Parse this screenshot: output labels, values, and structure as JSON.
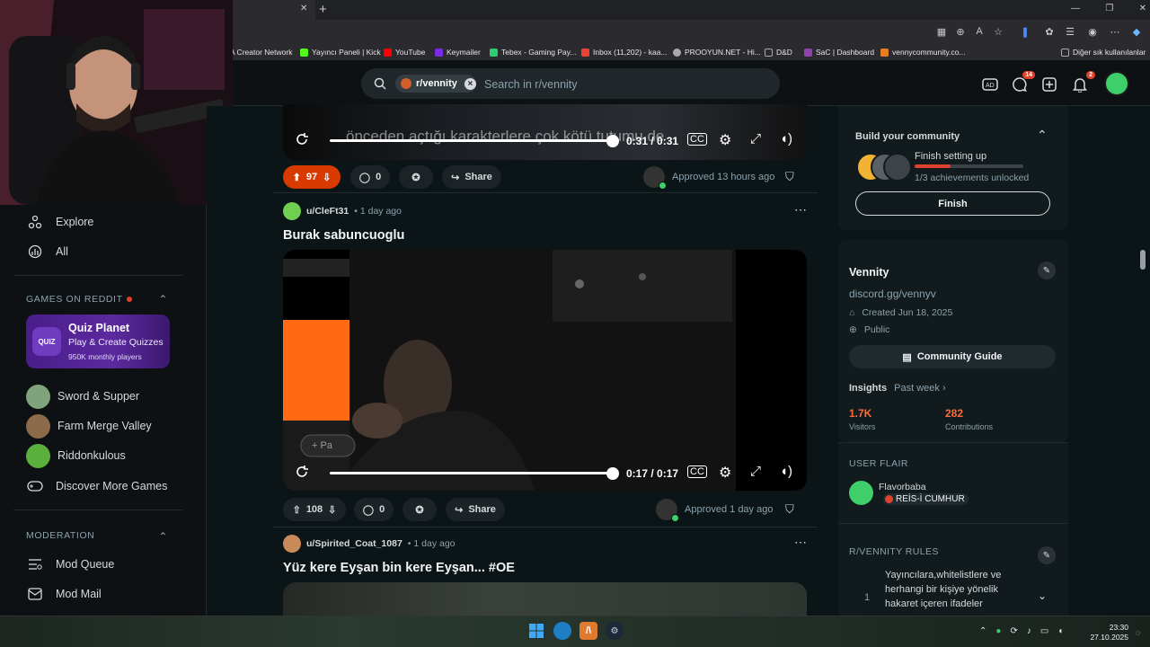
{
  "browser": {
    "tab_close": "✕",
    "new_tab": "+",
    "bookmarks": [
      {
        "label": "A Creator Network",
        "color": "#3b6fe0"
      },
      {
        "label": "Yayıncı Paneli | Kick",
        "color": "#53fc18"
      },
      {
        "label": "YouTube",
        "color": "#ff0000"
      },
      {
        "label": "Keymailer",
        "color": "#7d2ae8"
      },
      {
        "label": "Tebex - Gaming Pay...",
        "color": "#2ecc71"
      },
      {
        "label": "Inbox (11,202) - kaa...",
        "color": "#ea4335"
      },
      {
        "label": "PROOYUN.NET - Hi...",
        "color": "#aaaaaa"
      },
      {
        "label": "D&D",
        "color": "#aaaaaa"
      },
      {
        "label": "SaC | Dashboard",
        "color": "#8e44ad"
      },
      {
        "label": "vennycommunity.co...",
        "color": "#e67e22"
      }
    ],
    "other_bookmarks": "Diğer sık kullanılanlar",
    "window_controls": [
      "—",
      "❐",
      "✕"
    ]
  },
  "header": {
    "search_chip": "r/vennity",
    "search_placeholder": "Search in r/vennity",
    "chat_badge": "14",
    "notif_badge": "2"
  },
  "sidebar": {
    "nav": [
      {
        "label": "Explore",
        "icon": "explore-icon"
      },
      {
        "label": "All",
        "icon": "all-icon"
      }
    ],
    "games_header": "GAMES ON REDDIT",
    "quiz": {
      "title": "Quiz Planet",
      "subtitle": "Play & Create Quizzes",
      "players": "950K monthly players",
      "logo": "QUIZ"
    },
    "games": [
      {
        "label": "Sword & Supper",
        "color": "#7fa37a"
      },
      {
        "label": "Farm Merge Valley",
        "color": "#8c6b4a"
      },
      {
        "label": "Riddonkulous",
        "color": "#5ab03a"
      }
    ],
    "discover": "Discover More Games",
    "moderation_header": "MODERATION",
    "mod_items": [
      {
        "label": "Mod Queue",
        "icon": "mod-queue-icon"
      },
      {
        "label": "Mod Mail",
        "icon": "mod-mail-icon"
      }
    ]
  },
  "posts": [
    {
      "subtitle_overlay": "önceden açtığı karakterlere çok kötü tutumu de",
      "time": "0:31 / 0:31",
      "votes": "97",
      "comments": "0",
      "share": "Share",
      "approved": "Approved 13 hours ago",
      "upvote_color": "#d93a00"
    },
    {
      "author": "u/CleFt31",
      "age": "• 1 day ago",
      "title": "Burak sabuncuoglu",
      "time": "0:17 / 0:17",
      "votes": "108",
      "comments": "0",
      "share": "Share",
      "approved": "Approved 1 day ago",
      "video_button": "+ Pa"
    },
    {
      "author": "u/Spirited_Coat_1087",
      "age": "• 1 day ago",
      "title": "Yüz kere Eyşan bin kere Eyşan... #OE"
    }
  ],
  "right": {
    "build": {
      "title": "Build your community",
      "setup": "Finish setting up",
      "achievements": "1/3 achievements unlocked",
      "progress": 0.33,
      "finish": "Finish"
    },
    "community": {
      "name": "Vennity",
      "desc": "discord.gg/vennyv",
      "created": "Created Jun 18, 2025",
      "visibility": "Public",
      "guide": "Community Guide",
      "insights": "Insights",
      "period": "Past week ›",
      "visitors_value": "1.7K",
      "visitors_label": "Visitors",
      "contrib_value": "282",
      "contrib_label": "Contributions"
    },
    "flair": {
      "header": "USER FLAIR",
      "user": "Flavorbaba",
      "badge": "REİS-İ CUMHUR"
    },
    "rules": {
      "header": "R/VENNITY RULES",
      "items": [
        {
          "num": "1",
          "text": "Yayıncılara,whitelistlere ve herhangi bir kişiye yönelik hakaret içeren ifadeler"
        }
      ]
    }
  },
  "taskbar": {
    "time": "23:30",
    "date": "27.10.2025"
  },
  "colors": {
    "accent": "#d93a00",
    "online": "#3ecf6b",
    "background": "#0b1416"
  }
}
